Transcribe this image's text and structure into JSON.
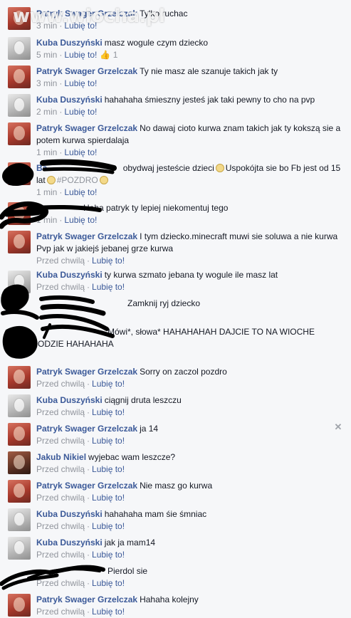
{
  "watermark": "www.wiocha.pl",
  "like_label": "Lubię to!",
  "comments": [
    {
      "author": "Patryk Swager Grzelczak",
      "text": "Tylko ruchac",
      "time": "3 min",
      "avatar": "red"
    },
    {
      "author": "Kuba Duszyński",
      "text": "masz wogule czym dziecko",
      "time": "5 min",
      "avatar": "grey",
      "likes": "1"
    },
    {
      "author": "Patryk Swager Grzelczak",
      "text": "Ty nie masz ale szanuje takich jak ty",
      "time": "3 min",
      "avatar": "red"
    },
    {
      "author": "Kuba Duszyński",
      "text": "hahahaha śmieszny jesteś jak taki pewny to cho na pvp",
      "time": "2 min",
      "avatar": "grey"
    },
    {
      "author": "Patryk Swager Grzelczak",
      "text": "No dawaj cioto kurwa znam takich jak ty kokszą sie a potem kurwa spierdalaja",
      "time": "1 min",
      "avatar": "red"
    },
    {
      "author": "Ba",
      "text": "obydwaj jesteście dzieci",
      "text2": "Uspokójta sie bo Fb jest od 15 lat",
      "text3": "#POZDRO",
      "time": "1 min",
      "avatar": "red"
    },
    {
      "author": "",
      "text": "Haha patryk ty lepiej niekomentuj tego",
      "time": "1 min",
      "avatar": "red"
    },
    {
      "author": "Patryk Swager Grzelczak",
      "text": "I tym dziecko.minecraft muwi sie soluwa a nie kurwa Pvp jak w jakiejś jebanej grze kurwa",
      "time": "Przed chwilą",
      "avatar": "red"
    },
    {
      "author": "Kuba Duszyński",
      "text": "ty kurwa szmato jebana ty wogule ile masz lat",
      "time": "Przed chwilą",
      "avatar": "grey"
    },
    {
      "author": "",
      "text": "Zamknij ryj dziecko",
      "time": "Przed chwilą",
      "avatar": "red"
    },
    {
      "author": "",
      "text": "Mówi*, słowa* HAHAHAHAH DAJCIE TO NA WIOCHE",
      "text2": "ODZIE HAHAHAHA",
      "avatar": "red"
    },
    {
      "author": "Patryk Swager Grzelczak",
      "text": "Sorry on zaczol pozdro",
      "time": "Przed chwilą",
      "avatar": "red"
    },
    {
      "author": "Kuba Duszyński",
      "text": "ciągnij druta leszczu",
      "time": "Przed chwilą",
      "avatar": "grey"
    },
    {
      "author": "Patryk Swager Grzelczak",
      "text": "ja 14",
      "time": "Przed chwilą",
      "avatar": "red"
    },
    {
      "author": "Jakub Nikiel",
      "text": "wyjebac wam leszcze?",
      "time": "Przed chwilą",
      "avatar": "jak"
    },
    {
      "author": "Patryk Swager Grzelczak",
      "text": "Nie masz go kurwa",
      "time": "Przed chwilą",
      "avatar": "red"
    },
    {
      "author": "Kuba Duszyński",
      "text": "hahahaha mam śie śmniac",
      "time": "Przed chwilą",
      "avatar": "grey"
    },
    {
      "author": "Kuba Duszyński",
      "text": "jak ja mam14",
      "time": "Przed chwilą",
      "avatar": "grey"
    },
    {
      "author": "",
      "text": "Pierdol sie",
      "time": "Przed chwilą",
      "avatar": "red"
    },
    {
      "author": "Patryk Swager Grzelczak",
      "text": "Hahaha kolejny",
      "time": "Przed chwilą",
      "avatar": "red"
    }
  ],
  "colors": {
    "author": "#3b5998",
    "meta": "#90949c",
    "background": "#f6f7f9",
    "scribble": "#000000"
  },
  "icons": {
    "close": "close-icon",
    "like": "thumbs-up-icon",
    "emoji": "smiley-icon"
  }
}
